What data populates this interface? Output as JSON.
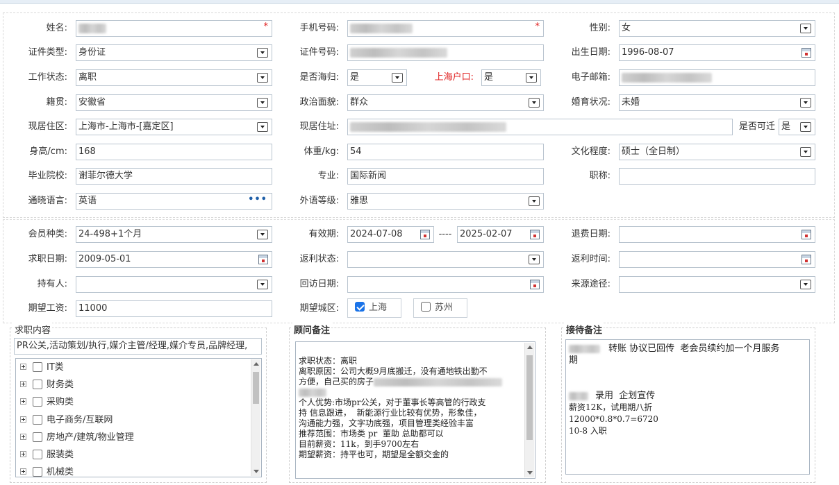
{
  "personal": {
    "name_label": "姓名:",
    "mobile_label": "手机号码:",
    "gender_label": "性别:",
    "gender_value": "女",
    "id_type_label": "证件类型:",
    "id_type_value": "身份证",
    "id_number_label": "证件号码:",
    "birth_date_label": "出生日期:",
    "birth_date_value": "1996-08-07",
    "work_status_label": "工作状态:",
    "work_status_value": "离职",
    "overseas_label": "是否海归:",
    "overseas_value": "是",
    "shanghai_hukou_label": "上海户口:",
    "shanghai_hukou_value": "是",
    "email_label": "电子邮箱:",
    "native_place_label": "籍贯:",
    "native_place_value": "安徽省",
    "political_label": "政治面貌:",
    "political_value": "群众",
    "marital_label": "婚育状况:",
    "marital_value": "未婚",
    "residence_area_label": "现居住区:",
    "residence_area_value": "上海市-上海市-[嘉定区]",
    "residence_address_label": "现居住址:",
    "relocate_label": "是否可迁",
    "relocate_value": "是",
    "height_label": "身高/cm:",
    "height_value": "168",
    "weight_label": "体重/kg:",
    "weight_value": "54",
    "education_label": "文化程度:",
    "education_value": "硕士（全日制）",
    "school_label": "毕业院校:",
    "school_value": "谢菲尔德大学",
    "major_label": "专业:",
    "major_value": "国际新闻",
    "title_label": "职称:",
    "languages_label": "通晓语言:",
    "languages_value": "英语",
    "foreign_level_label": "外语等级:",
    "foreign_level_value": "雅思"
  },
  "membership": {
    "member_type_label": "会员种类:",
    "member_type_value": "24-498+1个月",
    "validity_label": "有效期:",
    "valid_from": "2024-07-08",
    "range_sep": "----",
    "valid_to": "2025-02-07",
    "refund_date_label": "退费日期:",
    "job_search_date_label": "求职日期:",
    "job_search_date_value": "2009-05-01",
    "rebate_status_label": "返利状态:",
    "rebate_time_label": "返利时间:",
    "holder_label": "持有人:",
    "visit_date_label": "回访日期:",
    "source_label": "来源途径:",
    "expected_salary_label": "期望工资:",
    "expected_salary_value": "11000",
    "expected_city_label": "期望城区:",
    "city_shanghai": "上海",
    "city_suzhou": "苏州"
  },
  "panels": {
    "job_content_title": "求职内容",
    "job_content_value": "PR公关,活动策划/执行,媒介主管/经理,媒介专员,品牌经理,",
    "categories": [
      "IT类",
      "财务类",
      "采购类",
      "电子商务/互联网",
      "房地产/建筑/物业管理",
      "服装类",
      "机械类"
    ],
    "advisor_title": "顾问备注",
    "advisor_lines": {
      "l1": "求职状态：离职",
      "l2": "离职原因：公司大概9月底搬迁，没有通地铁出勤不",
      "l3": "方便，自己买的房子",
      "l4": "个人优势:市场pr公关，对于董事长等高管的行政支",
      "l5": "持 信息跟进，  新能源行业比较有优势，形象佳，",
      "l6": "沟通能力强，文字功底强，项目管理类经验丰富",
      "l7": "推荐范围：市场类 pr  董助 总助都可以",
      "l8": "目前薪资：11k，到手9700左右",
      "l9": "期望薪资：持平也可，期望是全额交金的"
    },
    "reception_title": "接待备注",
    "reception_lines": {
      "l1": "转账 协议已回传  老会员续约加一个月服务",
      "l2": "期",
      "l3": "录用  企划宣传",
      "l4": "薪资12K，试用期八折",
      "l5": "12000*0.8*0.7=6720",
      "l6": "10-8 入职"
    }
  }
}
